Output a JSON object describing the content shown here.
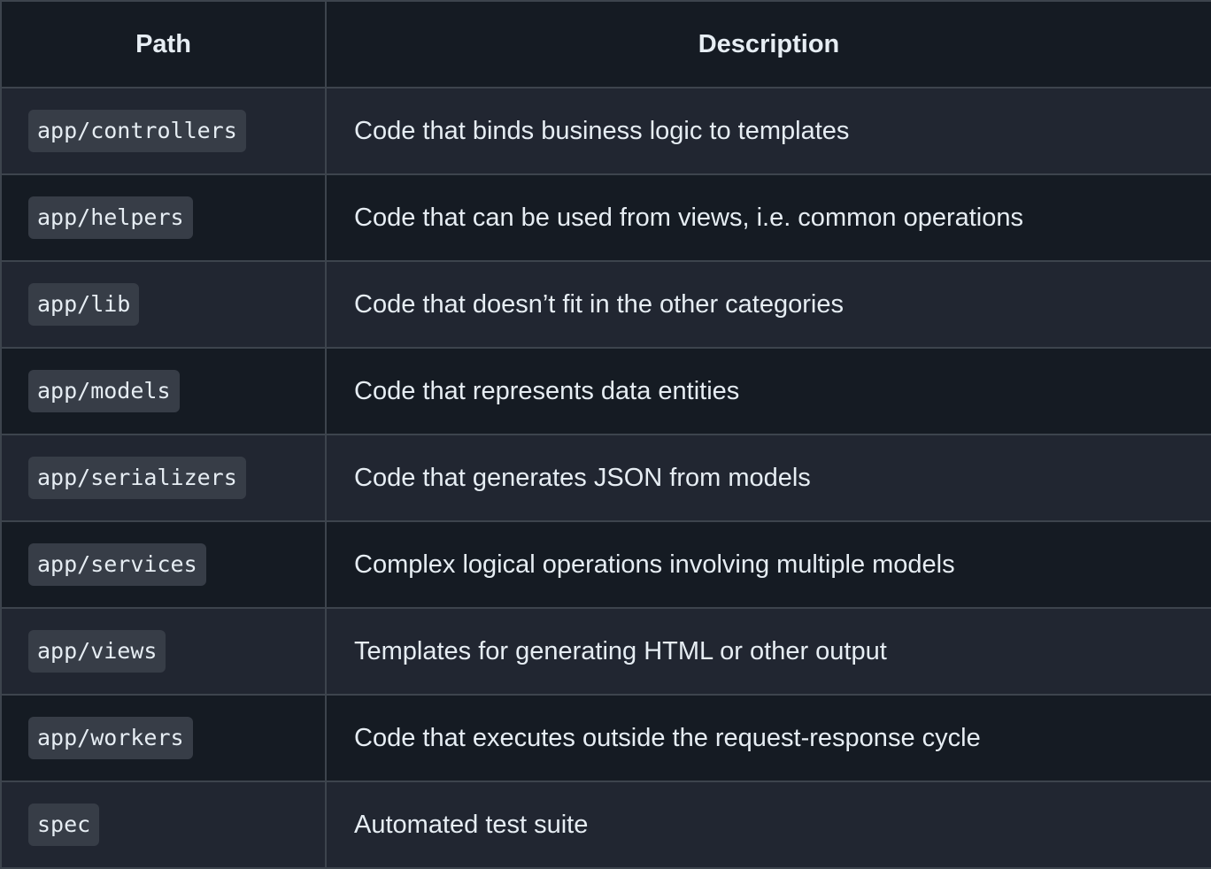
{
  "table": {
    "headers": {
      "path": "Path",
      "description": "Description"
    },
    "rows": [
      {
        "path": "app/controllers",
        "description": "Code that binds business logic to templates"
      },
      {
        "path": "app/helpers",
        "description": "Code that can be used from views, i.e. common operations"
      },
      {
        "path": "app/lib",
        "description": "Code that doesn’t fit in the other categories"
      },
      {
        "path": "app/models",
        "description": "Code that represents data entities"
      },
      {
        "path": "app/serializers",
        "description": "Code that generates JSON from models"
      },
      {
        "path": "app/services",
        "description": "Complex logical operations involving multiple models"
      },
      {
        "path": "app/views",
        "description": "Templates for generating HTML or other output"
      },
      {
        "path": "app/workers",
        "description": "Code that executes outside the request-response cycle"
      },
      {
        "path": "spec",
        "description": "Automated test suite"
      }
    ]
  },
  "colors": {
    "background_dark": "#151b23",
    "background_light": "#212631",
    "border": "#3d444d",
    "code_background": "#373d47",
    "text": "#e6edf3"
  }
}
